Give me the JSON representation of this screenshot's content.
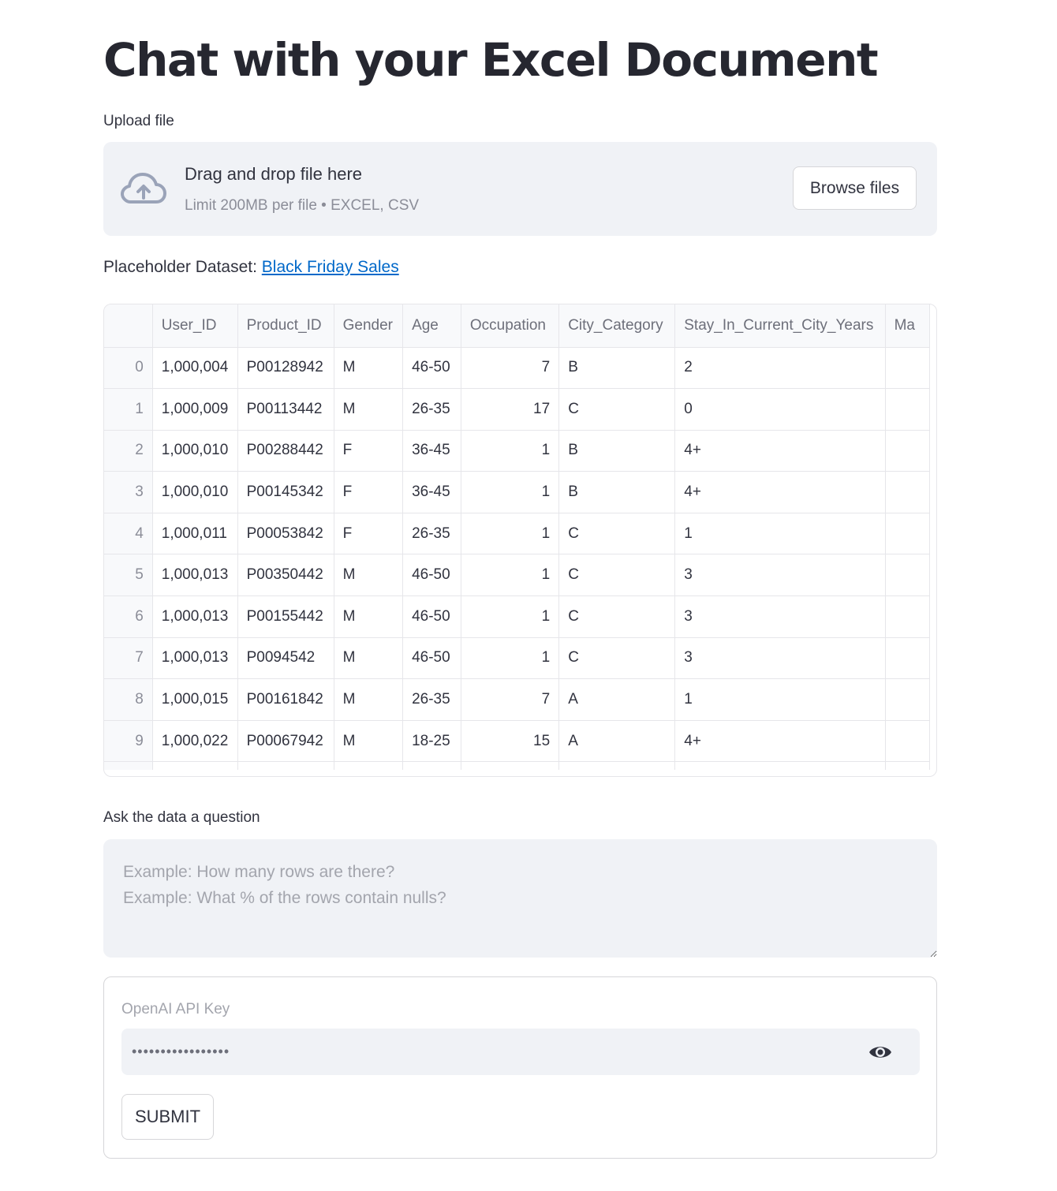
{
  "title": "Chat with your Excel Document",
  "upload": {
    "label": "Upload file",
    "drop_title": "Drag and drop file here",
    "limit": "Limit 200MB per file • EXCEL, CSV",
    "browse_label": "Browse files",
    "icon": "cloud-upload-icon"
  },
  "dataset": {
    "prefix": "Placeholder Dataset: ",
    "link_text": "Black Friday Sales"
  },
  "table": {
    "columns": [
      "",
      "User_ID",
      "Product_ID",
      "Gender",
      "Age",
      "Occupation",
      "City_Category",
      "Stay_In_Current_City_Years",
      "Ma"
    ],
    "rows": [
      [
        "0",
        "1,000,004",
        "P00128942",
        "M",
        "46-50",
        "7",
        "B",
        "2",
        ""
      ],
      [
        "1",
        "1,000,009",
        "P00113442",
        "M",
        "26-35",
        "17",
        "C",
        "0",
        ""
      ],
      [
        "2",
        "1,000,010",
        "P00288442",
        "F",
        "36-45",
        "1",
        "B",
        "4+",
        ""
      ],
      [
        "3",
        "1,000,010",
        "P00145342",
        "F",
        "36-45",
        "1",
        "B",
        "4+",
        ""
      ],
      [
        "4",
        "1,000,011",
        "P00053842",
        "F",
        "26-35",
        "1",
        "C",
        "1",
        ""
      ],
      [
        "5",
        "1,000,013",
        "P00350442",
        "M",
        "46-50",
        "1",
        "C",
        "3",
        ""
      ],
      [
        "6",
        "1,000,013",
        "P00155442",
        "M",
        "46-50",
        "1",
        "C",
        "3",
        ""
      ],
      [
        "7",
        "1,000,013",
        "P0094542",
        "M",
        "46-50",
        "1",
        "C",
        "3",
        ""
      ],
      [
        "8",
        "1,000,015",
        "P00161842",
        "M",
        "26-35",
        "7",
        "A",
        "1",
        ""
      ],
      [
        "9",
        "1,000,022",
        "P00067942",
        "M",
        "18-25",
        "15",
        "A",
        "4+",
        ""
      ],
      [
        "",
        "",
        "",
        "",
        "",
        "",
        "",
        "",
        ""
      ]
    ]
  },
  "question": {
    "label": "Ask the data a question",
    "placeholder": "Example: How many rows are there?\nExample: What % of the rows contain nulls?"
  },
  "api": {
    "label": "OpenAI API Key",
    "value": "sk-abcdefghijklmn",
    "toggle_icon": "eye-icon"
  },
  "submit_label": "SUBMIT",
  "colors": {
    "text": "#31333f",
    "link": "#0068c9",
    "panel": "#f0f2f6",
    "border": "#e6e6ea"
  }
}
